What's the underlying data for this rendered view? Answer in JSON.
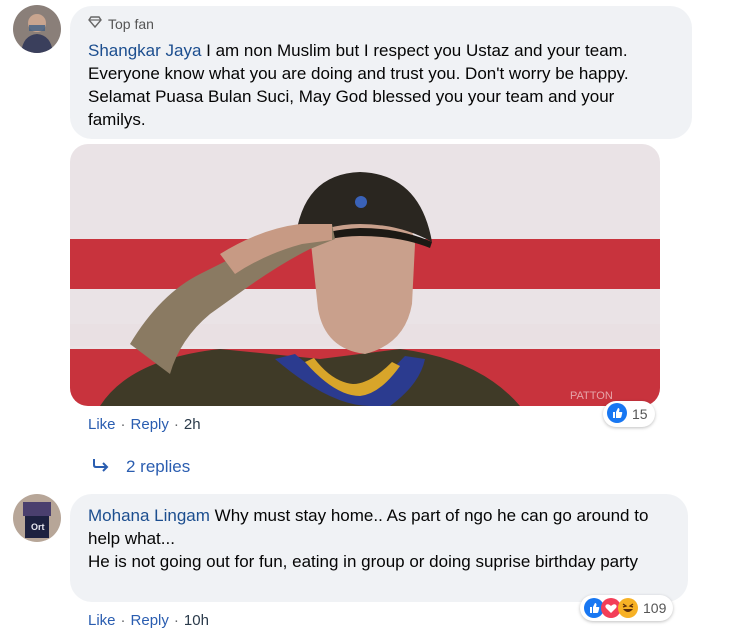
{
  "comments": [
    {
      "badge": "Top fan",
      "author": "Shangkar Jaya",
      "text": "I am non Muslim but I respect you Ustaz and your team. Everyone know what you are doing and trust you. Don't worry be happy. Selamat Puasa Bulan Suci, May God blessed you your team and your familys.",
      "actions": {
        "like": "Like",
        "reply": "Reply",
        "time": "2h"
      },
      "reaction_count": "15",
      "replies_label": "2 replies",
      "media_watermark": "PATTON"
    },
    {
      "author": "Mohana Lingam",
      "text_line1": "Why must stay home.. As part of ngo he can go around to help what...",
      "text_line2": "He is not going out for fun, eating in group or doing suprise birthday party",
      "actions": {
        "like": "Like",
        "reply": "Reply",
        "time": "10h"
      },
      "reaction_count": "109"
    }
  ],
  "colors": {
    "link": "#1c4e8f",
    "bubble": "#f0f2f5",
    "like_blue": "#1877f2",
    "love_red": "#f33e58",
    "haha_yellow": "#f7b125"
  },
  "icons": {
    "badge": "diamond-badge-icon",
    "replies": "reply-arrow-icon",
    "reactions": [
      "like-icon",
      "love-icon",
      "haha-icon"
    ]
  }
}
